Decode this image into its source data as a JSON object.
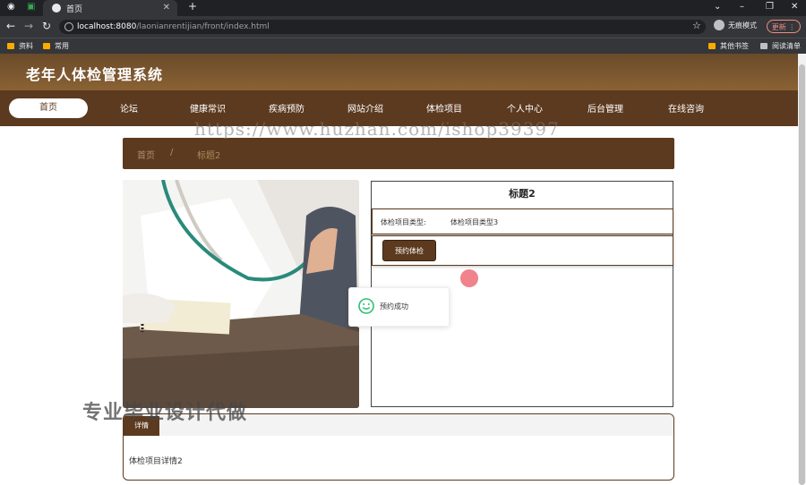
{
  "browser": {
    "tab_title": "首页",
    "url_host": "localhost:8080",
    "url_path": "/laonianrentijian/front/index.html",
    "incognito_label": "无痕模式",
    "update_label": "更新",
    "bookmarks": [
      "资料",
      "常用"
    ],
    "bookmarks_right": [
      "其他书签",
      "阅读清单"
    ]
  },
  "site": {
    "title": "老年人体检管理系统"
  },
  "nav": {
    "items": [
      "首页",
      "论坛",
      "健康常识",
      "疾病预防",
      "网站介绍",
      "体检项目",
      "个人中心",
      "后台管理",
      "在线咨询"
    ]
  },
  "breadcrumb": {
    "home": "首页",
    "separator": "/",
    "current": "标题2"
  },
  "detail": {
    "title": "标题2",
    "type_label": "体检项目类型:",
    "type_value": "体检项目类型3",
    "book_button": "预约体检"
  },
  "toast": {
    "message": "预约成功"
  },
  "details_section": {
    "tab_label": "详情",
    "content": "体检项目详情2"
  },
  "watermarks": {
    "url": "https://www.huzhan.com/ishop39397",
    "cn": "专业毕业设计代做"
  },
  "colors": {
    "brand_brown": "#5c3a1f",
    "header_gradient": "#8a6234"
  }
}
